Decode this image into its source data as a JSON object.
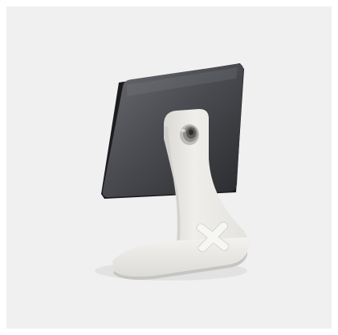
{
  "image": {
    "subject": "tablet-stand-product-photo",
    "colors": {
      "page_background": "#ffffff",
      "frame_background": "#f0f0f0",
      "screen_dark": "#2b2c2f",
      "screen_mid": "#55575c",
      "bezel_edge": "#1a1a1c",
      "stand_white": "#e9e8e5",
      "stand_shadow": "#cfcecb"
    }
  }
}
